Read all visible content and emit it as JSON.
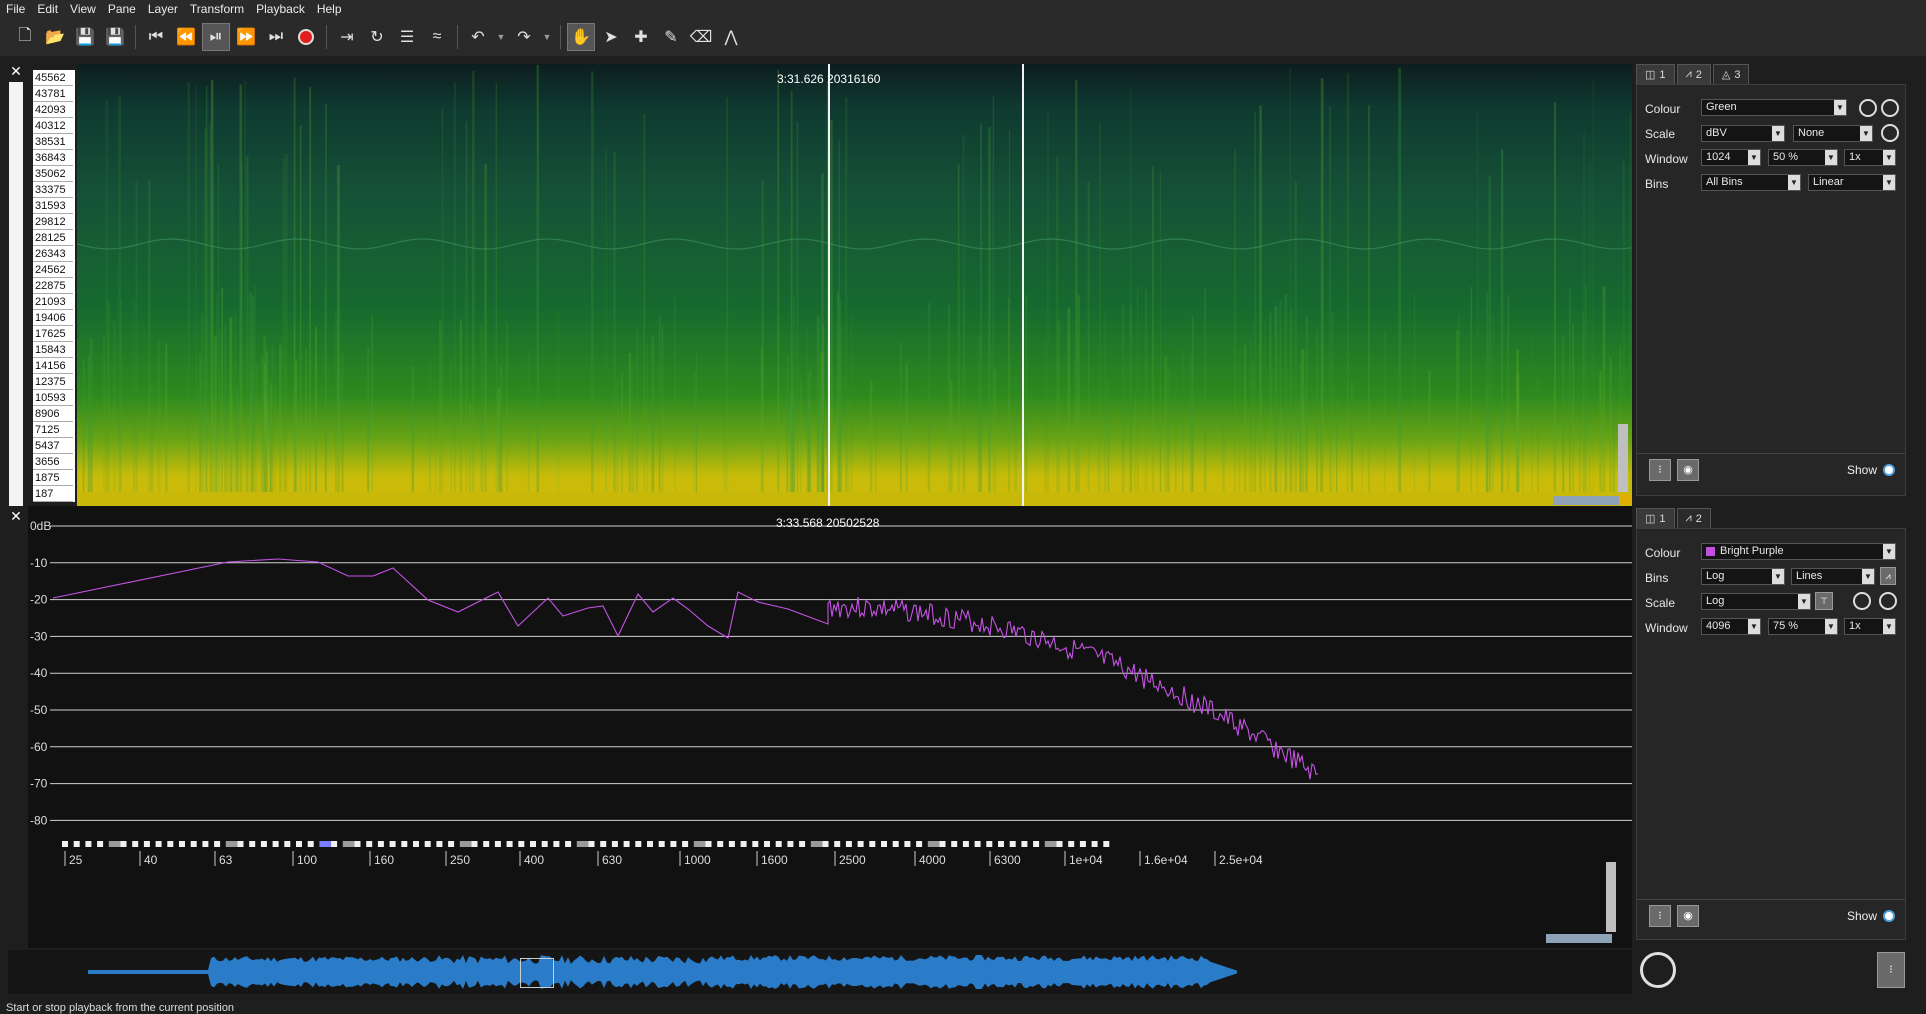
{
  "menu": [
    "File",
    "Edit",
    "View",
    "Pane",
    "Layer",
    "Transform",
    "Playback",
    "Help"
  ],
  "toolbar_icons": [
    "new-icon",
    "open-icon",
    "save-icon",
    "save-as-icon",
    "rewind-start-icon",
    "rewind-icon",
    "play-pause-icon",
    "fast-forward-icon",
    "fast-forward-end-icon",
    "record-icon",
    "play-selection-icon",
    "loop-icon",
    "solo-icon",
    "follow-playback-icon",
    "undo-icon",
    "redo-icon",
    "navigate-icon",
    "select-icon",
    "draw-icon",
    "edit-icon",
    "erase-icon",
    "measure-icon"
  ],
  "spectrogram": {
    "cursor_readout": "3:31.626  20316160",
    "freq_labels": [
      "45562",
      "43781",
      "42093",
      "40312",
      "38531",
      "36843",
      "35062",
      "33375",
      "31593",
      "29812",
      "28125",
      "26343",
      "24562",
      "22875",
      "21093",
      "19406",
      "17625",
      "15843",
      "14156",
      "12375",
      "10593",
      "8906",
      "7125",
      "5437",
      "3656",
      "1875",
      "187"
    ]
  },
  "spectrum": {
    "cursor_readout": "3:33.568  20502528",
    "db_labels": [
      "0dB",
      "-10",
      "-20",
      "-30",
      "-40",
      "-50",
      "-60",
      "-70",
      "-80"
    ],
    "x_labels": [
      "25",
      "40",
      "63",
      "100",
      "160",
      "250",
      "400",
      "630",
      "1000",
      "1600",
      "2500",
      "4000",
      "6300",
      "1e+04",
      "1.6e+04",
      "2.5e+04"
    ]
  },
  "props_top": {
    "tabs": [
      "1",
      "2",
      "3"
    ],
    "colour_label": "Colour",
    "colour_value": "Green",
    "scale_label": "Scale",
    "scale_value": "dBV",
    "scale_norm": "None",
    "window_label": "Window",
    "window_size": "1024",
    "window_overlap": "50 %",
    "window_zoom": "1x",
    "bins_label": "Bins",
    "bins_value": "All Bins",
    "bins_scale": "Linear",
    "show_label": "Show"
  },
  "props_bottom": {
    "tabs": [
      "1",
      "2"
    ],
    "colour_label": "Colour",
    "colour_value": "Bright Purple",
    "colour_swatch": "#c050e0",
    "bins_label": "Bins",
    "bins_value": "Log",
    "bins_mode": "Lines",
    "scale_label": "Scale",
    "scale_value": "Log",
    "window_label": "Window",
    "window_size": "4096",
    "window_overlap": "75 %",
    "window_zoom": "1x",
    "show_label": "Show"
  },
  "status_text": "Start or stop playback from the current position"
}
